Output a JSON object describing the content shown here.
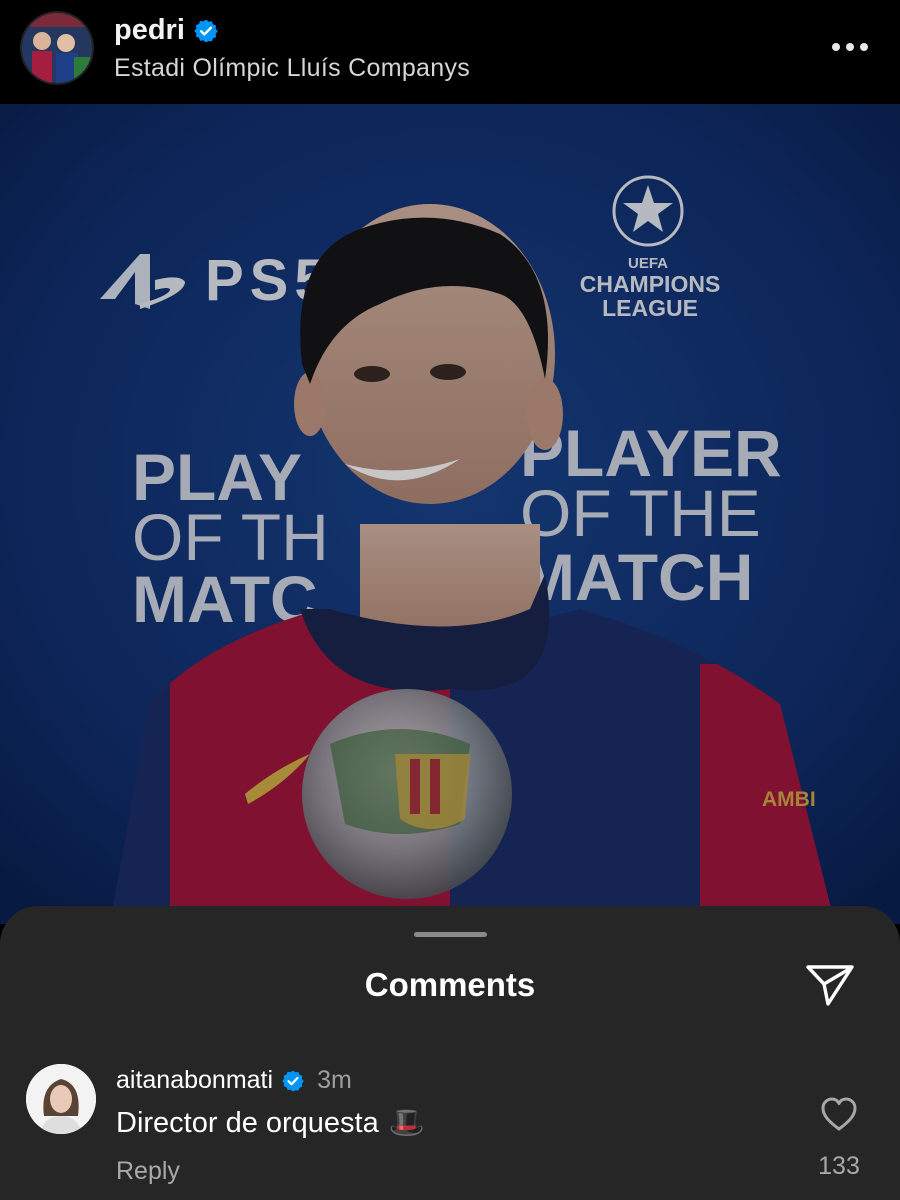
{
  "post": {
    "username": "pedri",
    "location": "Estadi Olímpic Lluís Companys",
    "verified": true,
    "photo": {
      "backdrop_texts": {
        "ps5": "PS5",
        "ucl_line1": "CHAMPIONS",
        "ucl_line2": "LEAGUE",
        "uefa": "UEFA",
        "potm_left_1": "PLAY",
        "potm_left_2": "OF TH",
        "potm_left_3": "MATC",
        "potm_right_1": "PLAYER",
        "potm_right_2": "OF THE",
        "potm_right_3": "MATCH",
        "sleeve": "AMBI"
      }
    }
  },
  "comments_sheet": {
    "title": "Comments",
    "comments": [
      {
        "username": "aitanabonmati",
        "verified": true,
        "time": "3m",
        "text": "Director de orquesta",
        "emoji": "🎩",
        "reply_label": "Reply",
        "likes": "133"
      }
    ]
  },
  "colors": {
    "header_bg": "#000000",
    "sheet_bg": "#262626",
    "verified_blue": "#0095f6",
    "muted_text": "#a8a8a8",
    "backdrop_blue": "#123574",
    "shirt_red": "#a5163f",
    "shirt_blue": "#1d2f6b"
  },
  "icons": {
    "header_more": "more-horizontal-icon",
    "verified": "verified-badge-icon",
    "send": "send-icon",
    "like": "heart-icon"
  }
}
